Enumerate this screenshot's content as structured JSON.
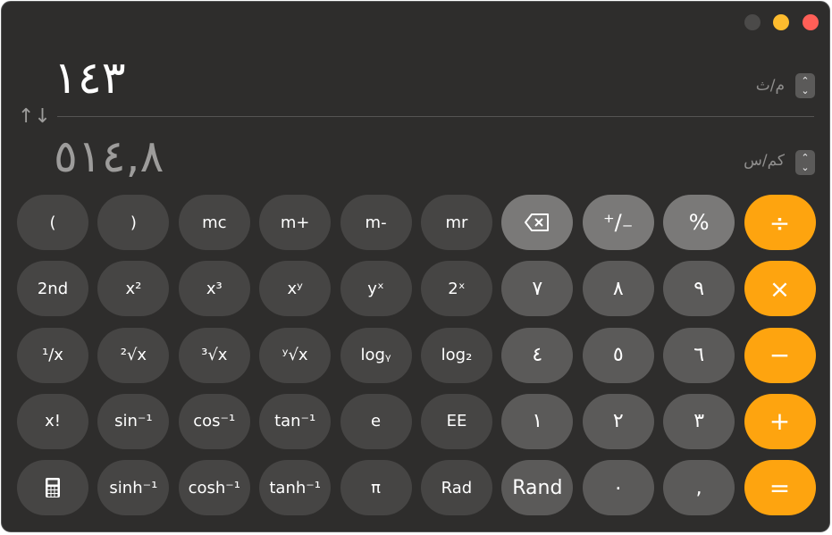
{
  "window": {
    "controls": [
      "minimize",
      "zoom",
      "close"
    ]
  },
  "display": {
    "input_value": "١٤٣",
    "input_unit": "م/ث",
    "output_value": "٥١٤,٨",
    "output_unit": "كم/س",
    "swap_icon": "↑↓",
    "stepper_icon": "chevron-up-down"
  },
  "colors": {
    "orange": "#fea40f",
    "function_key": "#464544",
    "digit_key": "#5b5a59",
    "top_operator_key": "#7a7978",
    "background": "#2e2d2c"
  },
  "keys": [
    {
      "label": "(",
      "type": "fn"
    },
    {
      "label": ")",
      "type": "fn"
    },
    {
      "label": "mc",
      "type": "fn"
    },
    {
      "label": "m+",
      "type": "fn"
    },
    {
      "label": "m-",
      "type": "fn"
    },
    {
      "label": "mr",
      "type": "fn"
    },
    {
      "label": "",
      "type": "op",
      "icon": "backspace-icon"
    },
    {
      "label": "⁺∕₋",
      "type": "op"
    },
    {
      "label": "%",
      "type": "op"
    },
    {
      "label": "÷",
      "type": "orange"
    },
    {
      "label": "2nd",
      "type": "fn"
    },
    {
      "label": "x²",
      "type": "fn"
    },
    {
      "label": "x³",
      "type": "fn"
    },
    {
      "label": "xʸ",
      "type": "fn"
    },
    {
      "label": "yˣ",
      "type": "fn"
    },
    {
      "label": "2ˣ",
      "type": "fn"
    },
    {
      "label": "٧",
      "type": "digit"
    },
    {
      "label": "٨",
      "type": "digit"
    },
    {
      "label": "٩",
      "type": "digit"
    },
    {
      "label": "×",
      "type": "orange"
    },
    {
      "label": "¹∕x",
      "type": "fn"
    },
    {
      "label": "²√x",
      "type": "fn"
    },
    {
      "label": "³√x",
      "type": "fn"
    },
    {
      "label": "ʸ√x",
      "type": "fn"
    },
    {
      "label": "logᵧ",
      "type": "fn"
    },
    {
      "label": "log₂",
      "type": "fn"
    },
    {
      "label": "٤",
      "type": "digit"
    },
    {
      "label": "٥",
      "type": "digit"
    },
    {
      "label": "٦",
      "type": "digit"
    },
    {
      "label": "−",
      "type": "orange"
    },
    {
      "label": "x!",
      "type": "fn"
    },
    {
      "label": "sin⁻¹",
      "type": "fn"
    },
    {
      "label": "cos⁻¹",
      "type": "fn"
    },
    {
      "label": "tan⁻¹",
      "type": "fn"
    },
    {
      "label": "e",
      "type": "fn"
    },
    {
      "label": "EE",
      "type": "fn"
    },
    {
      "label": "١",
      "type": "digit"
    },
    {
      "label": "٢",
      "type": "digit"
    },
    {
      "label": "٣",
      "type": "digit"
    },
    {
      "label": "+",
      "type": "orange"
    },
    {
      "label": "",
      "type": "fn",
      "icon": "calculator-icon"
    },
    {
      "label": "sinh⁻¹",
      "type": "fn"
    },
    {
      "label": "cosh⁻¹",
      "type": "fn"
    },
    {
      "label": "tanh⁻¹",
      "type": "fn"
    },
    {
      "label": "π",
      "type": "fn"
    },
    {
      "label": "Rad",
      "type": "fn"
    },
    {
      "label": "Rand",
      "type": "digit"
    },
    {
      "label": "٠",
      "type": "digit"
    },
    {
      "label": ",",
      "type": "digit"
    },
    {
      "label": "=",
      "type": "orange"
    }
  ]
}
